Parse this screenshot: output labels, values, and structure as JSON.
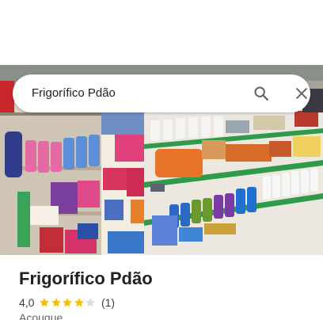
{
  "search": {
    "query": "Frigorífico Pdão"
  },
  "icons": {
    "search": "search-icon",
    "close": "close-icon",
    "star_full": "star-icon",
    "star_empty": "star-empty-icon"
  },
  "colors": {
    "star": "#fbbc04",
    "star_empty": "#dadce0",
    "text": "#202124",
    "muted": "#5f6368"
  },
  "place": {
    "name": "Frigorífico Pdão",
    "rating_text": "4,0",
    "rating": 4,
    "max_rating": 5,
    "reviews_text": "(1)",
    "category": "Açougue"
  },
  "photo": {
    "subject": "store-shelves-photo"
  }
}
